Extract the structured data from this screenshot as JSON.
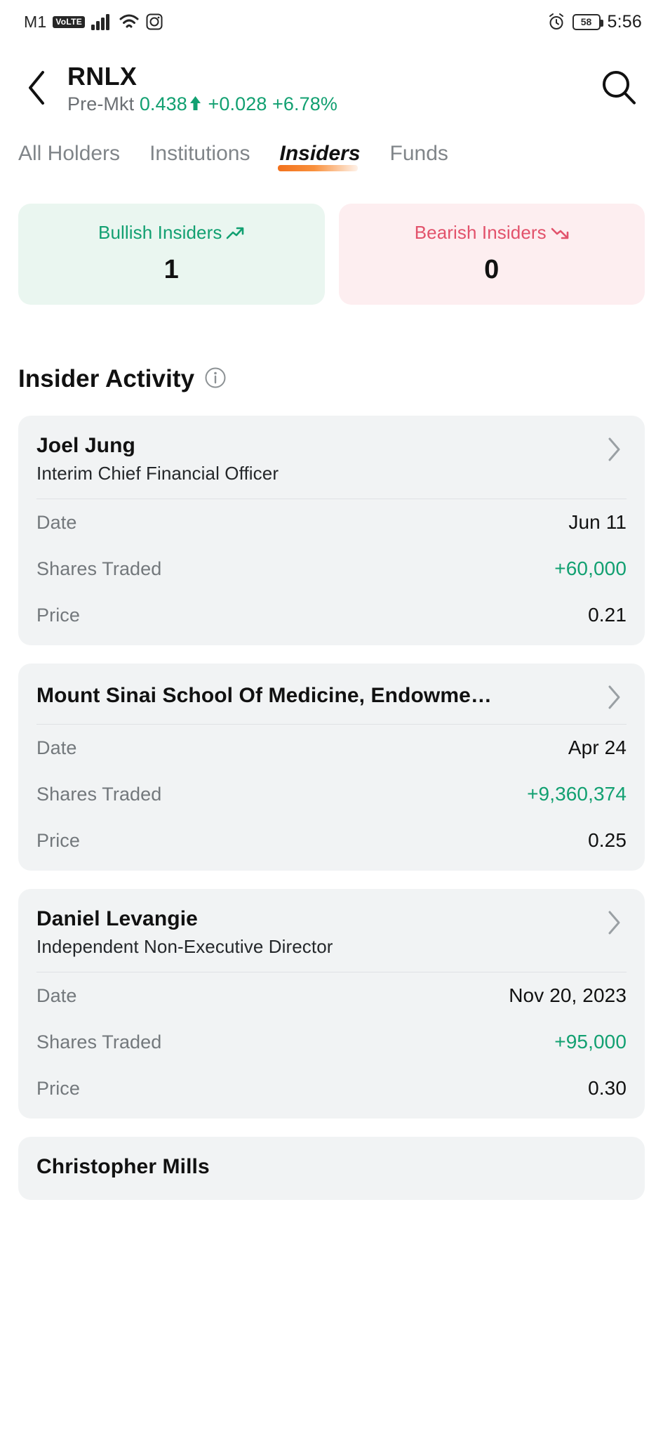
{
  "status_bar": {
    "carrier": "M1",
    "volte": "VoLTE",
    "signal_icon": "signal-bars-icon",
    "wifi_icon": "wifi-icon",
    "screen_record_icon": "screen-record-icon",
    "alarm_icon": "alarm-clock-icon",
    "battery_level": "58",
    "time": "5:56"
  },
  "header": {
    "back_icon": "back-chevron-icon",
    "ticker": "RNLX",
    "quote": {
      "session_label": "Pre-Mkt",
      "price": "0.438",
      "direction_icon": "arrow-up-icon",
      "change": "+0.028",
      "change_pct": "+6.78%"
    },
    "search_icon": "search-icon"
  },
  "tabs": [
    {
      "label": "All Holders",
      "active": false
    },
    {
      "label": "Institutions",
      "active": false
    },
    {
      "label": "Insiders",
      "active": true
    },
    {
      "label": "Funds",
      "active": false
    }
  ],
  "sentiment": {
    "bullish": {
      "label": "Bullish Insiders",
      "icon": "trend-up-icon",
      "value": "1",
      "color": "#12a071"
    },
    "bearish": {
      "label": "Bearish Insiders",
      "icon": "trend-down-icon",
      "value": "0",
      "color": "#e2526b"
    }
  },
  "section": {
    "title": "Insider Activity",
    "info_icon": "info-circle-icon"
  },
  "row_labels": {
    "date": "Date",
    "shares_traded": "Shares Traded",
    "price": "Price"
  },
  "insiders": [
    {
      "name": "Joel Jung",
      "role": "Interim Chief Financial Officer",
      "date": "Jun 11",
      "shares_traded": "+60,000",
      "price": "0.21",
      "chevron_icon": "chevron-right-icon"
    },
    {
      "name": "Mount Sinai School Of Medicine, Endowme…",
      "role": "",
      "date": "Apr 24",
      "shares_traded": "+9,360,374",
      "price": "0.25",
      "chevron_icon": "chevron-right-icon"
    },
    {
      "name": "Daniel Levangie",
      "role": "Independent Non-Executive Director",
      "date": "Nov 20, 2023",
      "shares_traded": "+95,000",
      "price": "0.30",
      "chevron_icon": "chevron-right-icon"
    },
    {
      "name": "Christopher Mills",
      "role": "",
      "date": "",
      "shares_traded": "",
      "price": "",
      "chevron_icon": "chevron-right-icon"
    }
  ]
}
